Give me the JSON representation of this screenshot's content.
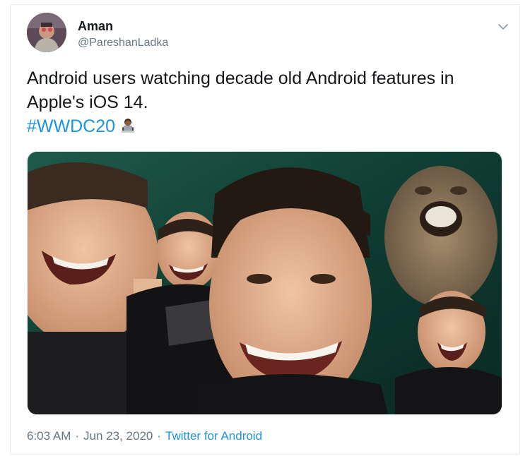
{
  "tweet": {
    "author": {
      "display_name": "Aman",
      "handle": "@PareshanLadka"
    },
    "text_line1": "Android users watching decade old Android features in",
    "text_line2": "Apple's iOS 14.",
    "hashtag": "#WWDC20",
    "hashtag_emoji_icon": "man-technologist-emoji-icon",
    "media": {
      "alt": "Meme: man laughing, repeated in a collage with a laughing monkey"
    },
    "meta": {
      "time": "6:03 AM",
      "separator": "·",
      "date": "Jun 23, 2020",
      "source": "Twitter for Android"
    }
  },
  "colors": {
    "link": "#1b95e0",
    "secondary_text": "#657786",
    "border": "#e6ecf0"
  }
}
